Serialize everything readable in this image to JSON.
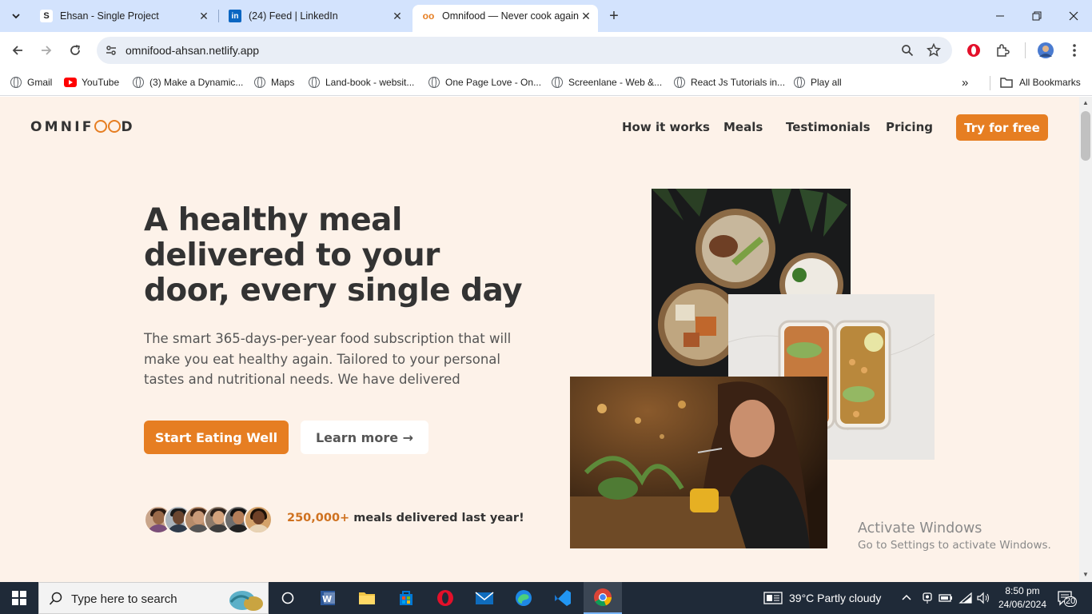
{
  "browser": {
    "tabs": [
      {
        "title": "Ehsan - Single Project",
        "favicon": "S"
      },
      {
        "title": "(24) Feed | LinkedIn",
        "favicon": "in"
      },
      {
        "title": "Omnifood — Never cook again",
        "favicon": "oo",
        "active": true
      }
    ],
    "url": "omnifood-ahsan.netlify.app",
    "bookmarks": [
      {
        "label": "Gmail",
        "icon": "globe-icon"
      },
      {
        "label": "YouTube",
        "icon": "youtube-icon"
      },
      {
        "label": "(3) Make a Dynamic...",
        "icon": "globe-icon"
      },
      {
        "label": "Maps",
        "icon": "globe-icon"
      },
      {
        "label": "Land-book - websit...",
        "icon": "globe-icon"
      },
      {
        "label": "One Page Love - On...",
        "icon": "globe-icon"
      },
      {
        "label": "Screenlane - Web &...",
        "icon": "globe-icon"
      },
      {
        "label": "React Js Tutorials in...",
        "icon": "globe-icon"
      },
      {
        "label": "Play all",
        "icon": "globe-icon"
      }
    ],
    "all_bookmarks": "All Bookmarks"
  },
  "site": {
    "logo": {
      "pre": "OMNIF",
      "post": "D"
    },
    "nav": [
      "How it works",
      "Meals",
      "Testimonials",
      "Pricing"
    ],
    "nav_cta": "Try for free",
    "hero": {
      "title": "A healthy meal delivered to your door, every single day",
      "text": "The smart 365-days-per-year food subscription that will make you eat healthy again. Tailored to your personal tastes and nutritional needs. We have delivered",
      "primary_cta": "Start Eating Well",
      "secondary_cta": "Learn more →",
      "delivered_count": "250,000+",
      "delivered_text": "meals delivered last year!"
    },
    "accent_color": "#e67e22",
    "background_color": "#fdf2e9"
  },
  "watermark": {
    "line1": "Activate Windows",
    "line2": "Go to Settings to activate Windows."
  },
  "taskbar": {
    "search_placeholder": "Type here to search",
    "weather": "39°C  Partly cloudy",
    "time": "8:50 pm",
    "date": "24/06/2024",
    "notifications": "20"
  }
}
